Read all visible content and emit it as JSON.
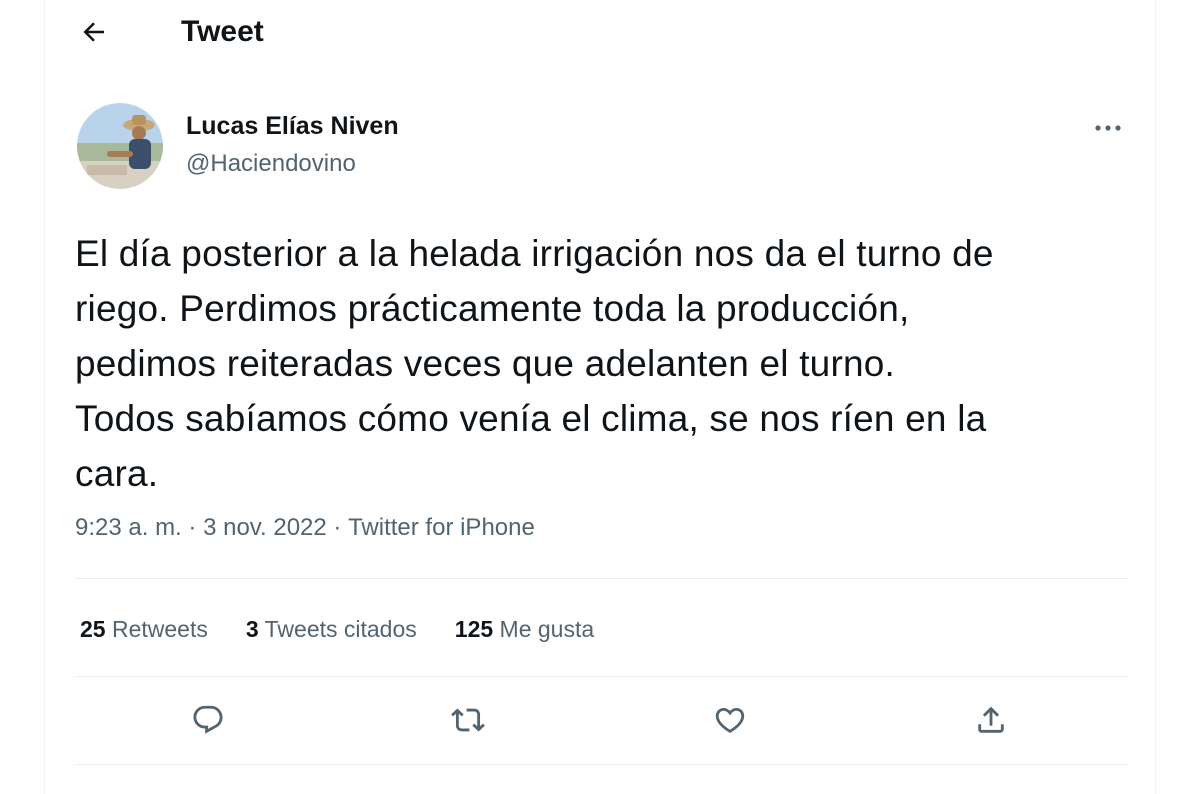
{
  "header": {
    "title": "Tweet",
    "back_icon": "arrow-left-icon"
  },
  "tweet": {
    "author": {
      "name": "Lucas Elías Niven",
      "handle": "@Haciendovino"
    },
    "text": "El día posterior a la helada irrigación nos da el turno de\nriego. Perdimos prácticamente toda la producción,\npedimos reiteradas veces que adelanten el turno.\nTodos sabíamos cómo venía el clima, se nos ríen en la\ncara.",
    "time": "9:23 a. m.",
    "separator": "·",
    "date": "3 nov. 2022",
    "source": "Twitter for iPhone"
  },
  "stats": {
    "retweets": {
      "count": "25",
      "label": "Retweets"
    },
    "quotes": {
      "count": "3",
      "label": "Tweets citados"
    },
    "likes": {
      "count": "125",
      "label": "Me gusta"
    }
  },
  "actions": [
    "reply-icon",
    "retweet-icon",
    "like-icon",
    "share-icon"
  ],
  "colors": {
    "text": "#0f1419",
    "secondary": "#536471",
    "divider": "#e8ecee"
  }
}
